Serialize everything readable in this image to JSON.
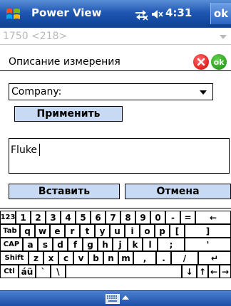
{
  "titlebar": {
    "title": "Power View",
    "clock": "4:31",
    "ok_label": "ok",
    "icons": [
      "windows-start-icon",
      "connectivity-icon",
      "volume-icon"
    ]
  },
  "dim_combo": {
    "value": "1750 <218>"
  },
  "header": {
    "label": "Описание измерения",
    "ok_label": "ok"
  },
  "company_select": {
    "value": "Company:"
  },
  "apply_label": "Применить",
  "text_input": {
    "value": "Fluke"
  },
  "insert_label": "Вставить",
  "cancel_label": "Отмена",
  "keyboard": {
    "rows": [
      [
        "123",
        "1",
        "2",
        "3",
        "4",
        "5",
        "6",
        "7",
        "8",
        "9",
        "0",
        "-",
        "=",
        "←"
      ],
      [
        "Tab",
        "q",
        "w",
        "e",
        "r",
        "t",
        "y",
        "u",
        "i",
        "o",
        "p",
        "[",
        "]"
      ],
      [
        "CAP",
        "a",
        "s",
        "d",
        "f",
        "g",
        "h",
        "j",
        "k",
        "l",
        ";",
        "'"
      ],
      [
        "Shift",
        "z",
        "x",
        "c",
        "v",
        "b",
        "n",
        "m",
        ",",
        ".",
        "/",
        "↵"
      ],
      [
        "Ctl",
        "áü",
        "`",
        "\\",
        "",
        "↓",
        "↑",
        "←",
        "→"
      ]
    ]
  },
  "colors": {
    "titlebar": "#1f57b3",
    "button_fill": "#c8daf3",
    "cancel_circle": "#d40000",
    "ok_circle": "#1a8a12"
  }
}
